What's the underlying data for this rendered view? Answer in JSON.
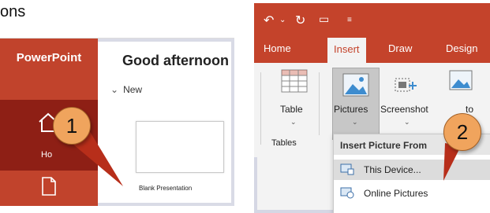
{
  "caption": "ons",
  "panel1": {
    "rail_title": "PowerPoint",
    "home_label": "Ho",
    "greeting": "Good afternoon",
    "new_label": "New",
    "blank_label": "Blank Presentation",
    "step_number": "1"
  },
  "panel2": {
    "tabs": [
      "Home",
      "Insert",
      "Draw",
      "Design"
    ],
    "active_tab": "Insert",
    "buttons": {
      "table": "Table",
      "pictures": "Pictures",
      "screenshot": "Screenshot",
      "photo_album_partial": "to"
    },
    "group_label": "Tables",
    "menu": {
      "header": "Insert Picture From",
      "items": [
        "This Device...",
        "Online Pictures"
      ]
    },
    "step_number": "2"
  },
  "colors": {
    "accent": "#c4432b",
    "dark_accent": "#8e1f15",
    "step_circle": "#f0a45d"
  }
}
